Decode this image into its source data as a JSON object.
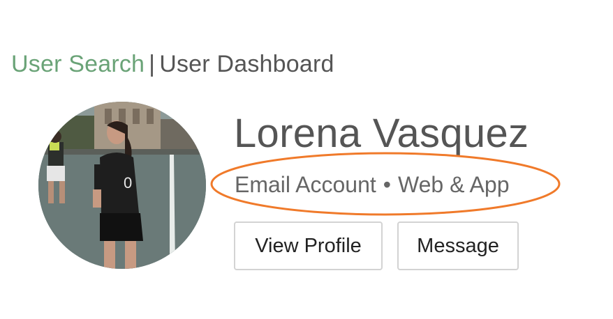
{
  "breadcrumb": {
    "link_label": "User Search",
    "separator": "|",
    "current_label": "User Dashboard",
    "link_color": "#6aa377"
  },
  "profile": {
    "name": "Lorena Vasquez",
    "account_type": "Email Account",
    "separator": "•",
    "platform": "Web & App",
    "avatar_icon": "user-photo"
  },
  "actions": {
    "view_profile_label": "View Profile",
    "message_label": "Message"
  },
  "annotation": {
    "oval_color": "#f07a2a"
  }
}
